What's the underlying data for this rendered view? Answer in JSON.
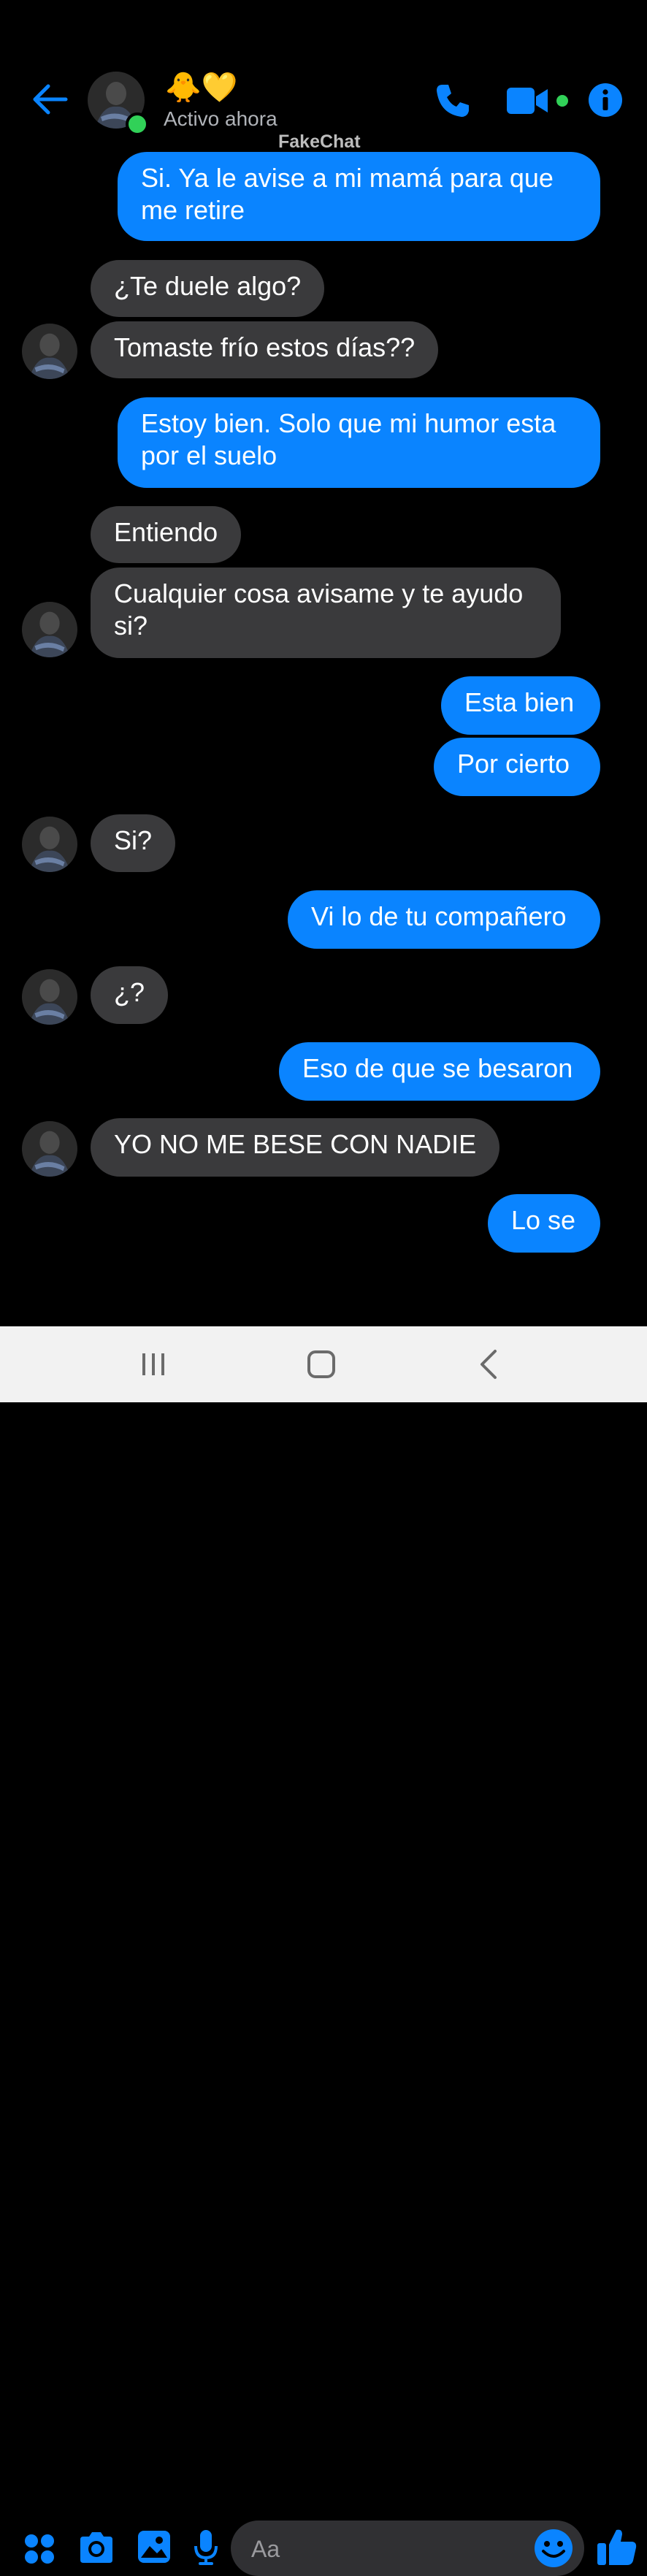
{
  "header": {
    "contact_name": "🐥💛",
    "status": "Activo ahora",
    "brand": "FakeChat",
    "icons": [
      "back-arrow-icon",
      "phone-icon",
      "video-camera-icon",
      "info-icon"
    ],
    "accent_color": "#0a84ff",
    "online_color": "#31d158"
  },
  "messages": [
    {
      "sender": "me",
      "text": "Si. Ya le avise a mi mamá para que me retire"
    },
    {
      "sender": "them",
      "text": "¿Te duele algo?"
    },
    {
      "sender": "them",
      "text": "Tomaste frío estos días??"
    },
    {
      "sender": "me",
      "text": "Estoy bien. Solo que mi humor esta por el suelo"
    },
    {
      "sender": "them",
      "text": "Entiendo"
    },
    {
      "sender": "them",
      "text": "Cualquier cosa avisame y te ayudo si?"
    },
    {
      "sender": "me",
      "text": "Esta bien"
    },
    {
      "sender": "me",
      "text": "Por cierto"
    },
    {
      "sender": "them",
      "text": "Si?"
    },
    {
      "sender": "me",
      "text": "Vi lo de tu compañero"
    },
    {
      "sender": "them",
      "text": "¿?"
    },
    {
      "sender": "me",
      "text": "Eso de que se besaron"
    },
    {
      "sender": "them",
      "text": "YO NO ME BESE CON NADIE"
    },
    {
      "sender": "me",
      "text": "Lo se"
    }
  ],
  "composer": {
    "placeholder": "Aa",
    "icons": [
      "apps-grid-icon",
      "camera-icon",
      "gallery-icon",
      "microphone-icon",
      "emoji-icon",
      "thumbs-up-icon"
    ]
  },
  "navbar": {
    "icons": [
      "recent-apps-icon",
      "home-icon",
      "back-icon"
    ]
  },
  "colors": {
    "background": "#000000",
    "outgoing_bubble": "#0a84ff",
    "incoming_bubble": "#3a3a3c"
  }
}
